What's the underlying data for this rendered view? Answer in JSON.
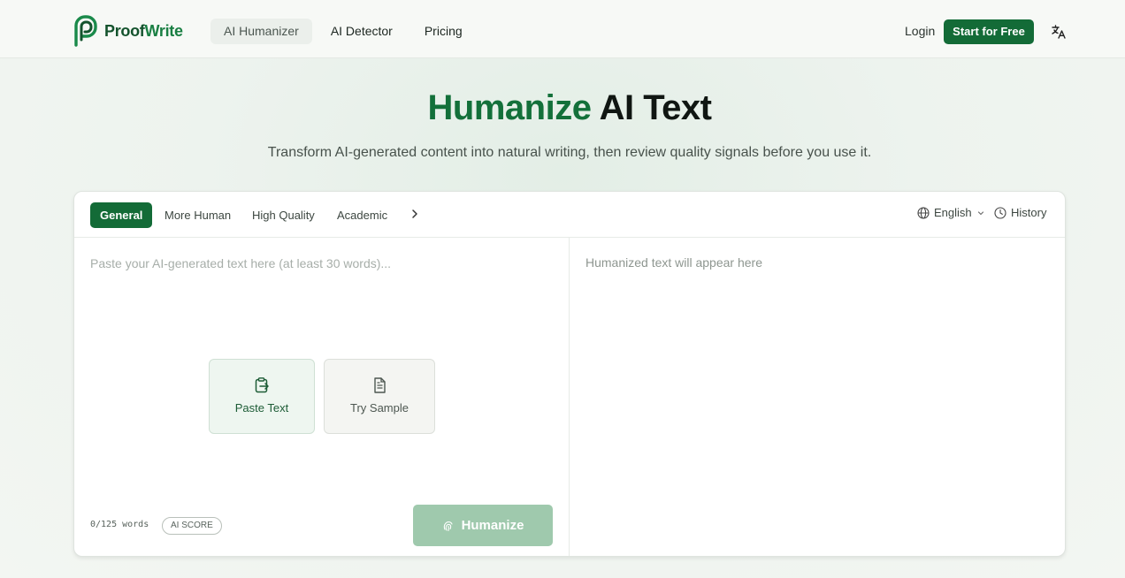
{
  "brand": {
    "name_part1": "Proof",
    "name_part2": "Write",
    "accent_color": "#136b37"
  },
  "nav": {
    "items": [
      {
        "label": "AI Humanizer",
        "active": true
      },
      {
        "label": "AI Detector",
        "active": false
      },
      {
        "label": "Pricing",
        "active": false
      }
    ],
    "login_label": "Login",
    "start_label": "Start for Free",
    "translate_icon": "translate-icon"
  },
  "hero": {
    "title_accent": "Humanize",
    "title_rest": "AI Text",
    "subtitle": "Transform AI-generated content into natural writing, then review quality signals before you use it."
  },
  "editor": {
    "modes": [
      {
        "label": "General",
        "active": true
      },
      {
        "label": "More Human",
        "active": false
      },
      {
        "label": "High Quality",
        "active": false
      },
      {
        "label": "Academic",
        "active": false
      }
    ],
    "language": "English",
    "history_label": "History",
    "input_placeholder": "Paste your AI-generated text here (at least 30 words)...",
    "output_placeholder": "Humanized text will appear here",
    "paste_label": "Paste Text",
    "sample_label": "Try Sample",
    "word_count": "0/125 words",
    "ai_score_label": "AI SCORE",
    "humanize_label": "Humanize"
  }
}
